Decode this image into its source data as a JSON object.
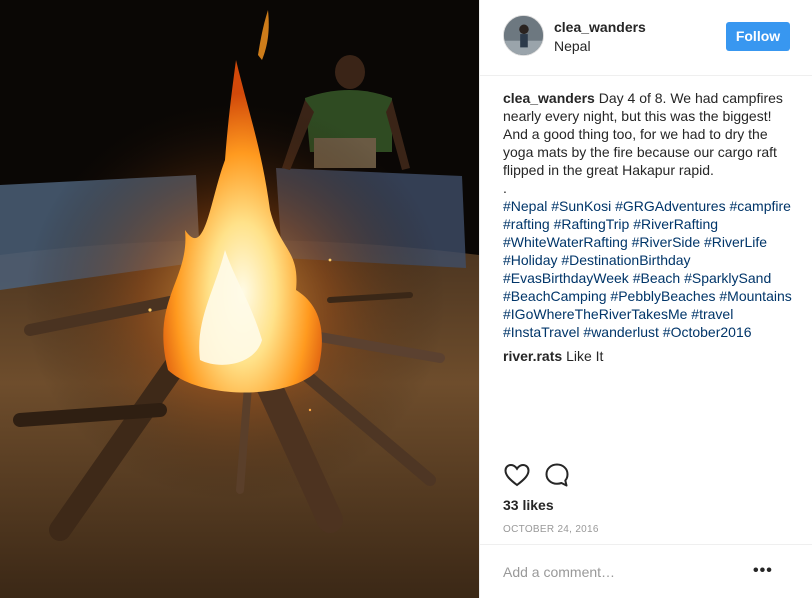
{
  "post": {
    "user": {
      "username": "clea_wanders",
      "location": "Nepal",
      "follow_label": "Follow",
      "avatar_icon": "avatar-photo"
    },
    "caption": {
      "username": "clea_wanders",
      "text": "Day 4 of 8. We had campfires nearly every night, but this was the biggest! And a good thing too, for we had to dry the yoga mats by the fire because our cargo raft flipped in the great Hakapur rapid.",
      "separator": ".",
      "hashtags": [
        "#Nepal",
        "#SunKosi",
        "#GRGAdventures",
        "#campfire",
        "#rafting",
        "#RaftingTrip",
        "#RiverRafting",
        "#WhiteWaterRafting",
        "#RiverSide",
        "#RiverLife",
        "#Holiday",
        "#DestinationBirthday",
        "#EvasBirthdayWeek",
        "#Beach",
        "#SparklySand",
        "#BeachCamping",
        "#PebblyBeaches",
        "#Mountains",
        "#IGoWhereTheRiverTakesMe",
        "#travel",
        "#InstaTravel",
        "#wanderlust",
        "#October2016"
      ]
    },
    "comments": [
      {
        "username": "river.rats",
        "text": "Like It"
      }
    ],
    "actions": {
      "like_icon": "heart-icon",
      "comment_icon": "speech-bubble-icon"
    },
    "likes_label": "33 likes",
    "date": "OCTOBER 24, 2016",
    "add_comment_placeholder": "Add a comment…",
    "more_icon": "ellipsis-icon",
    "colors": {
      "follow": "#3897f0",
      "hashtag": "#003569",
      "muted": "#999999",
      "text": "#262626"
    }
  }
}
